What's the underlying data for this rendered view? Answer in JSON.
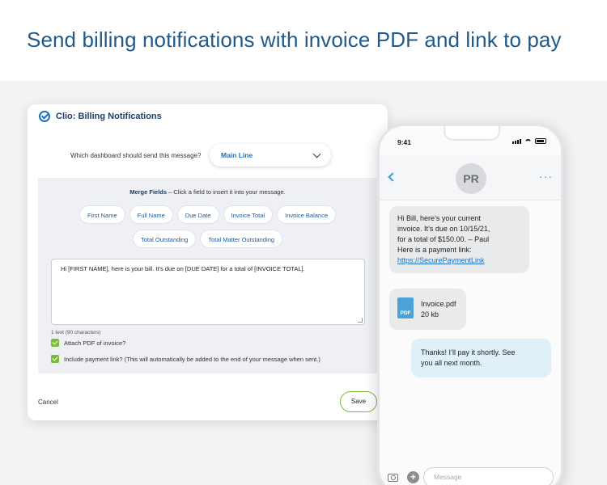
{
  "headline": "Send billing notifications with invoice PDF and link to pay",
  "card": {
    "title": "Clio: Billing Notifications",
    "dashboard_question": "Which dashboard should send this message?",
    "dashboard_value": "Main Line",
    "merge_label": "Merge Fields",
    "merge_hint": " – Click a field to insert it into your message.",
    "chips_row1": [
      "First Name",
      "Full Name",
      "Due Date",
      "Invoice Total",
      "Invoice Balance"
    ],
    "chips_row2": [
      "Total Outstanding",
      "Total Matter Outstanding"
    ],
    "message": "Hi [FIRST NAME], here is your bill. It's due on [DUE DATE] for a total of [INVOICE TOTAL].",
    "char_count": "1 text (90 characters)",
    "attach_pdf": "Attach PDF of invoice?",
    "include_link": "Include payment link? (This will automatically be added to the end of your message when sent.)",
    "cancel": "Cancel",
    "save": "Save"
  },
  "phone": {
    "time": "9:41",
    "avatar_initials": "PR",
    "more": "···",
    "incoming_message_lines": [
      "Hi Bill, here’s your current",
      "invoice. It’s due on 10/15/21,",
      "for a total of $150.00. – Paul",
      "Here is a payment link:"
    ],
    "payment_link": "https://SecurePaymentLink",
    "attachment_icon_text": "PDF",
    "attachment_name": "Invoice.pdf",
    "attachment_size": "20 kb",
    "outgoing_message_lines": [
      "Thanks! I’ll pay it shortly. See",
      "you all next month."
    ],
    "input_placeholder": "Message"
  },
  "colors": {
    "brand_blue": "#1f5a8a",
    "accent_green": "#7bbb3a",
    "link_blue": "#1d6fc1",
    "pdf_icon": "#4aa3d4"
  }
}
